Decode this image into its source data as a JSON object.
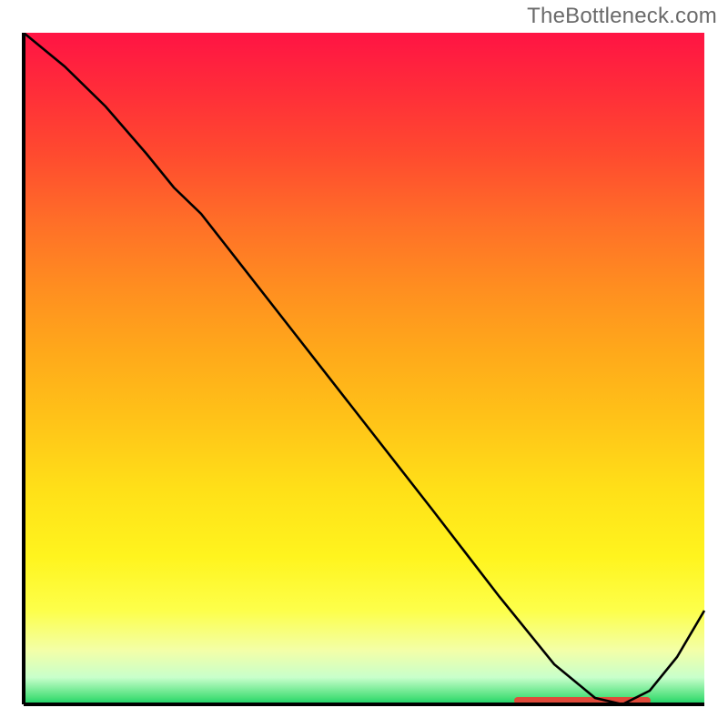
{
  "watermark": "TheBottleneck.com",
  "chart_data": {
    "type": "line",
    "title": "",
    "xlabel": "",
    "ylabel": "",
    "xlim": [
      0,
      100
    ],
    "ylim": [
      0,
      100
    ],
    "series": [
      {
        "name": "curve",
        "x": [
          0,
          6,
          12,
          18,
          22,
          26,
          30,
          40,
          50,
          60,
          70,
          78,
          84,
          88,
          92,
          96,
          100
        ],
        "y": [
          100,
          95,
          89,
          82,
          77,
          73,
          68,
          55,
          42,
          29,
          16,
          6,
          1,
          0,
          2,
          7,
          14
        ]
      }
    ],
    "marker_bar": {
      "x_start": 72,
      "x_end": 92,
      "y": 0
    },
    "background_gradient": {
      "top": "#ff1444",
      "mid": "#fff41e",
      "bottom": "#19d267"
    }
  }
}
